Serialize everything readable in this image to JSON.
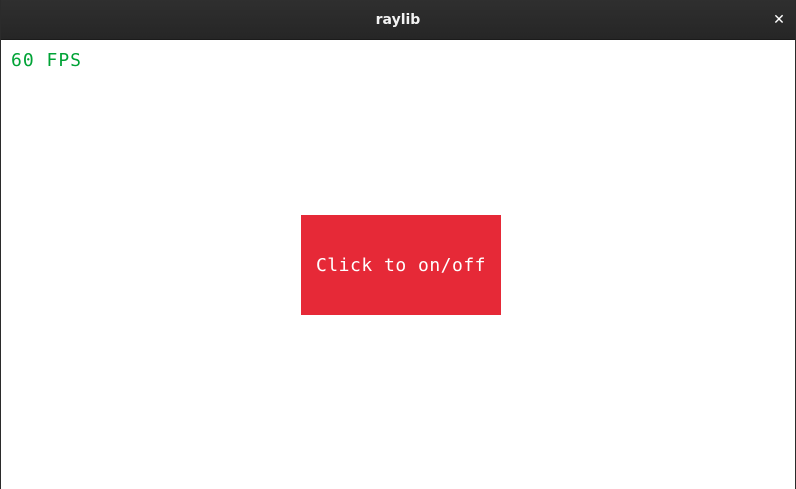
{
  "window": {
    "title": "raylib",
    "close_glyph": "✕"
  },
  "canvas": {
    "fps_text": "60 FPS",
    "toggle_button": {
      "label": "Click to on/off",
      "color": "#e62937"
    },
    "fps_color": "#00a336",
    "background": "#ffffff"
  }
}
